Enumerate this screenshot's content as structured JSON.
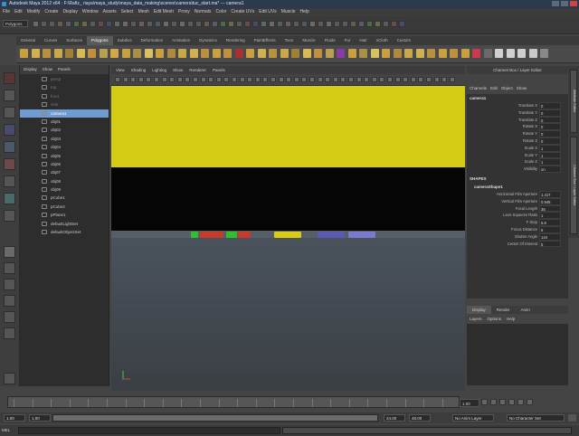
{
  "window": {
    "title": "Autodesk Maya 2012 x64 : F:\\Rafiz_ riaya\\maya_study\\maya_data_making\\scenes\\camera\\tuc_start.ma* --- camera1"
  },
  "menubar": [
    "File",
    "Edit",
    "Modify",
    "Create",
    "Display",
    "Window",
    "Assets",
    "Select",
    "Mesh",
    "Edit Mesh",
    "Proxy",
    "Normals",
    "Color",
    "Create UVs",
    "Edit UVs",
    "Muscle",
    "Help"
  ],
  "status_line": {
    "mode": "Polygons"
  },
  "shelf_tabs": [
    "General",
    "Curves",
    "Surfaces",
    "Polygons",
    "Subdivs",
    "Deformation",
    "Animation",
    "Dynamics",
    "Rendering",
    "PaintEffects",
    "Toon",
    "Muscle",
    "Fluids",
    "Fur",
    "Hair",
    "nCloth",
    "Custom"
  ],
  "shelf_active": "Polygons",
  "outliner": {
    "menu": [
      "Display",
      "Show",
      "Panels"
    ],
    "items": [
      {
        "label": "persp",
        "state": "dim"
      },
      {
        "label": "top",
        "state": "dim"
      },
      {
        "label": "front",
        "state": "dim"
      },
      {
        "label": "side",
        "state": "dim"
      },
      {
        "label": "camera1",
        "state": "selected"
      },
      {
        "label": "obj01",
        "state": "normal"
      },
      {
        "label": "obj02",
        "state": "normal"
      },
      {
        "label": "obj03",
        "state": "normal"
      },
      {
        "label": "obj04",
        "state": "normal"
      },
      {
        "label": "obj05",
        "state": "normal"
      },
      {
        "label": "obj06",
        "state": "normal"
      },
      {
        "label": "obj07",
        "state": "normal"
      },
      {
        "label": "obj08",
        "state": "normal"
      },
      {
        "label": "obj09",
        "state": "normal"
      },
      {
        "label": "pCube1",
        "state": "normal"
      },
      {
        "label": "pCube2",
        "state": "normal"
      },
      {
        "label": "pPlane1",
        "state": "normal"
      },
      {
        "label": "defaultLightSet",
        "state": "normal"
      },
      {
        "label": "defaultObjectSet",
        "state": "normal"
      }
    ]
  },
  "viewport": {
    "menu": [
      "View",
      "Shading",
      "Lighting",
      "Show",
      "Renderer",
      "Panels"
    ],
    "colors": {
      "gate_top": "#d4cc14",
      "gate_black": "#050505"
    }
  },
  "channel_box": {
    "title": "Channel Box / Layer Editor",
    "tabs": [
      "Channels",
      "Edit",
      "Object",
      "Show"
    ],
    "object_name": "camera1",
    "transform": [
      {
        "label": "Translate X",
        "value": "0"
      },
      {
        "label": "Translate Y",
        "value": "0"
      },
      {
        "label": "Translate Z",
        "value": "0"
      },
      {
        "label": "Rotate X",
        "value": "0"
      },
      {
        "label": "Rotate Y",
        "value": "0"
      },
      {
        "label": "Rotate Z",
        "value": "0"
      },
      {
        "label": "Scale X",
        "value": "1"
      },
      {
        "label": "Scale Y",
        "value": "1"
      },
      {
        "label": "Scale Z",
        "value": "1"
      },
      {
        "label": "Visibility",
        "value": "on"
      }
    ],
    "shapes_header": "SHAPES",
    "shape_name": "cameraShape1",
    "shape_attrs": [
      {
        "label": "Horizontal Film Aperture",
        "value": "1.417"
      },
      {
        "label": "Vertical Film Aperture",
        "value": "0.945"
      },
      {
        "label": "Focal Length",
        "value": "35"
      },
      {
        "label": "Lens Squeeze Ratio",
        "value": "1"
      },
      {
        "label": "F Stop",
        "value": "5.6"
      },
      {
        "label": "Focus Distance",
        "value": "5"
      },
      {
        "label": "Shutter Angle",
        "value": "144"
      },
      {
        "label": "Center Of Interest",
        "value": "5"
      }
    ]
  },
  "side_tabs": [
    "Attribute Editor",
    "Channel Box / Layer Editor"
  ],
  "layer_editor": {
    "tabs": [
      "Display",
      "Render",
      "Anim"
    ],
    "menu": [
      "Layers",
      "Options",
      "Help"
    ]
  },
  "time": {
    "current": "1.00",
    "start": "1.00",
    "range_start": "1.00",
    "range_end": "24.00",
    "end": "48.00",
    "anim_layer": "No Anim Layer",
    "char_set": "No Character Set"
  },
  "command_line": {
    "label": "MEL"
  }
}
